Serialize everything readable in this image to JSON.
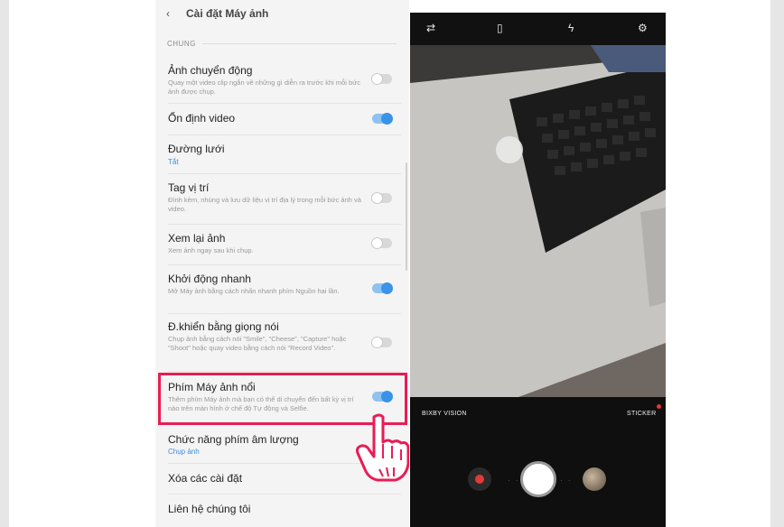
{
  "settings": {
    "title": "Cài đặt Máy ảnh",
    "back_glyph": "‹",
    "section": "CHUNG",
    "items": [
      {
        "title": "Ảnh chuyển động",
        "subtitle": "Quay một video clip ngắn về những gì diễn ra trước khi mỗi bức ảnh được chụp.",
        "toggle": false
      },
      {
        "title": "Ổn định video",
        "toggle": true
      },
      {
        "title": "Đường lưới",
        "value": "Tắt"
      },
      {
        "title": "Tag vị trí",
        "subtitle": "Đính kèm, nhúng và lưu dữ liệu vị trí địa lý trong mỗi bức ảnh và video.",
        "toggle": false
      },
      {
        "title": "Xem lại ảnh",
        "subtitle": "Xem ảnh ngay sau khi chụp.",
        "toggle": false
      },
      {
        "title": "Khởi động nhanh",
        "subtitle": "Mở Máy ảnh bằng cách nhấn nhanh phím Nguồn hai lần.",
        "toggle": true
      },
      {
        "title": "Đ.khiển bằng giọng nói",
        "subtitle": "Chụp ảnh bằng cách nói \"Smile\", \"Cheese\", \"Capture\" hoặc \"Shoot\" hoặc quay video bằng cách nói \"Record Video\".",
        "toggle": false
      },
      {
        "title": "Phím Máy ảnh nổi",
        "subtitle": "Thêm phím Máy ảnh mà bạn có thể di chuyển đến bất kỳ vị trí nào trên màn hình ở chế độ Tự động và Selfie.",
        "toggle": true
      },
      {
        "title": "Chức năng phím âm lượng",
        "value": "Chụp ảnh"
      },
      {
        "title": "Xóa các cài đặt"
      },
      {
        "title": "Liên hệ chúng tôi"
      }
    ]
  },
  "camera": {
    "top_icons": [
      "switch-camera-icon",
      "aspect-ratio-icon",
      "flash-off-icon",
      "gear-icon"
    ],
    "top_glyphs": [
      "⇄",
      "▯",
      "ϟ",
      "⚙"
    ],
    "mode_left": "BIXBY VISION",
    "mode_right": "STICKER",
    "dots": "· ·"
  },
  "colors": {
    "highlight": "#e81d55",
    "toggle_on": "#3a93e6",
    "value_text": "#3b8fd8"
  }
}
